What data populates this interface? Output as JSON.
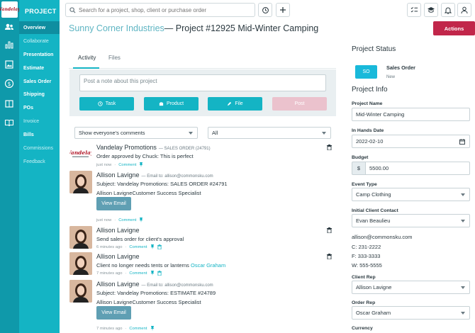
{
  "brand": {
    "logo_text": "Vandelay",
    "accent": "#14b4c4",
    "rail": "#0f99aa",
    "primary": "#c1264a"
  },
  "rail_icons": [
    "users-icon",
    "chart-icon",
    "image-icon",
    "dollar-icon",
    "building-icon",
    "book-icon"
  ],
  "nav": {
    "title": "PROJECT",
    "items": [
      {
        "label": "Overview"
      },
      {
        "label": "Collaborate"
      },
      {
        "label": "Presentation"
      },
      {
        "label": "Estimate"
      },
      {
        "label": "Sales Order"
      },
      {
        "label": "Shipping"
      },
      {
        "label": "POs"
      },
      {
        "label": "Invoice"
      },
      {
        "label": "Bills"
      },
      {
        "label": "Commissions"
      },
      {
        "label": "Feedback"
      }
    ]
  },
  "search": {
    "placeholder": "Search for a project, shop, client or purchase order"
  },
  "header": {
    "client": "Sunny Corner Industries",
    "project": "— Project #12925 Mid-Winter Camping",
    "actions_label": "Actions"
  },
  "tabs": {
    "activity": "Activity",
    "files": "Files"
  },
  "note": {
    "placeholder": "Post a note about this project",
    "buttons": {
      "task": "Task",
      "product": "Product",
      "file": "File",
      "post": "Post"
    }
  },
  "filters": {
    "comments": "Show everyone's comments",
    "type": "All"
  },
  "feed": [
    {
      "name": "Vandelay Promotions",
      "meta": "— SALES ORDER (24791)",
      "line1": "Order approved by Chuck: This is perfect",
      "time": "just now",
      "comment": "Comment"
    },
    {
      "name": "Allison Lavigne",
      "meta": "— Email to: allison@commonsku.com",
      "line1": "Subject: Vandelay Promotions: SALES ORDER #24791",
      "line2": "Allison LavigneCustomer Success Specialist",
      "button": "View Email",
      "time": "just now",
      "comment": "Comment"
    },
    {
      "name": "Allison Lavigne",
      "line1": "Send sales order for client's approval",
      "time": "6 minutes ago",
      "comment": "Comment"
    },
    {
      "name": "Allison Lavigne",
      "line1": "Client no longer needs tents or lanterns",
      "mention": "Oscar Graham",
      "time": "7 minutes ago",
      "comment": "Comment"
    },
    {
      "name": "Allison Lavigne",
      "meta": "— Email to: allison@commonsku.com",
      "line1": "Subject: Vandelay Promotions: ESTIMATE #24789",
      "line2": "Allison LavigneCustomer Success Specialist",
      "button": "View Email",
      "time": "7 minutes ago",
      "comment": "Comment"
    }
  ],
  "status": {
    "heading": "Project Status",
    "badge": "SO",
    "stage": "Sales Order",
    "sub": "New"
  },
  "info": {
    "heading": "Project Info",
    "name_label": "Project Name",
    "name_value": "Mid-Winter Camping",
    "date_label": "In Hands Date",
    "date_value": "2022-02-10",
    "budget_label": "Budget",
    "budget_prefix": "$",
    "budget_value": "5500.00",
    "event_label": "Event Type",
    "event_value": "Camp Clothing",
    "contact_label": "Initial Client Contact",
    "contact_value": "Evan Beaulieu",
    "email": "allison@commonsku.com",
    "cell": "C: 231-2222",
    "fax": "F: 333-3333",
    "work": "W: 555-5555",
    "client_rep_label": "Client Rep",
    "client_rep_value": "Allison Lavigne",
    "order_rep_label": "Order Rep",
    "order_rep_value": "Oscar Graham",
    "currency_label": "Currency"
  }
}
